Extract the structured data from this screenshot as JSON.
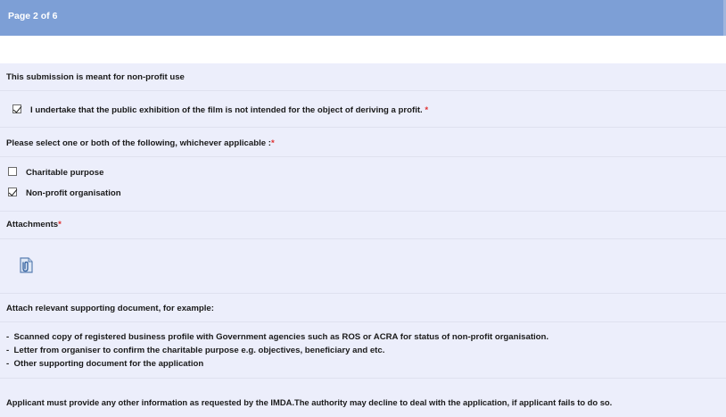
{
  "header": {
    "page_indicator": "Page 2 of 6"
  },
  "form": {
    "section_title": "This submission is meant for non-profit use",
    "undertaking": {
      "label": "I undertake that the public exhibition of the film is not intended for the object of deriving a profit.",
      "required_marker": "*",
      "checked": true
    },
    "select_prompt": {
      "label": "Please select one or both of the following, whichever applicable :",
      "required_marker": "*"
    },
    "options": [
      {
        "label": "Charitable purpose",
        "checked": false
      },
      {
        "label": "Non-profit organisation",
        "checked": true
      }
    ],
    "attachments": {
      "label": "Attachments",
      "required_marker": "*",
      "icon": "attach-file-icon"
    },
    "supporting_docs": {
      "intro": "Attach relevant supporting document, for example:",
      "items": [
        "Scanned copy of registered business profile with Government agencies such as ROS or ACRA for status of non-profit organisation.",
        "Letter from organiser to confirm the charitable purpose e.g. objectives, beneficiary and etc.",
        "Other supporting document for the application"
      ],
      "bullet": "-"
    },
    "notice": "Applicant must provide any other information as requested by the IMDA.The authority may decline to deal with the application, if applicant fails to do so."
  },
  "colors": {
    "header_bg": "#7d9fd6",
    "content_bg": "#eceefb",
    "required": "#e03030"
  }
}
